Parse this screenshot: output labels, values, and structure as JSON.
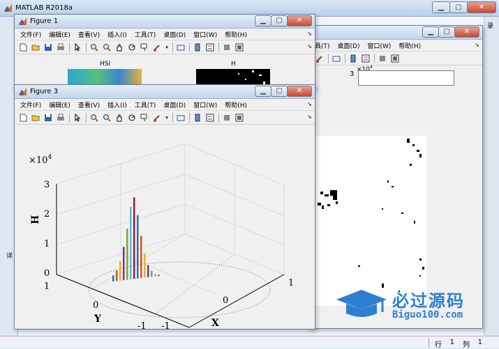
{
  "app": {
    "title": "MATLAB R2018a",
    "status_row_label": "行",
    "status_row_value": "1",
    "status_col_label": "列",
    "status_col_value": "1",
    "partial_left_label": "详",
    "partial_right_label": "录"
  },
  "window_buttons": {
    "minimize": "▁",
    "maximize": "▢",
    "close": "✕"
  },
  "menu": [
    "文件(F)",
    "编辑(E)",
    "查看(V)",
    "插入(I)",
    "工具(T)",
    "桌面(D)",
    "窗口(W)",
    "帮助(H)"
  ],
  "menu_overflow": "➘",
  "figure1": {
    "title": "Figure 1",
    "subplot_titles": [
      "HSI",
      "H"
    ]
  },
  "figure2": {
    "visible_menu": [
      "具(T)",
      "桌面(D)",
      "窗口(W)",
      "帮助(H)"
    ],
    "axis_exponent": "×10",
    "axis_exponent_power": "4",
    "axis_tick": "3"
  },
  "figure3": {
    "title": "Figure 3",
    "axes": {
      "z_exponent": "×10",
      "z_exponent_power": "4",
      "z_label": "H",
      "x_label": "X",
      "y_label": "Y",
      "z_ticks": [
        "0",
        "1",
        "2",
        "3"
      ],
      "y_ticks": [
        "1",
        "0",
        "-1"
      ],
      "x_ticks": [
        "-1",
        "0",
        "1"
      ]
    }
  },
  "watermark": {
    "main": "必过源码",
    "sub": "Biguo100.com"
  },
  "toolbar_icons": [
    "new-file-icon",
    "open-file-icon",
    "save-icon",
    "print-icon",
    "pointer-icon",
    "zoom-in-icon",
    "zoom-out-icon",
    "pan-icon",
    "rotate-3d-icon",
    "data-cursor-icon",
    "brush-icon",
    "link-icon",
    "colorbar-icon",
    "legend-icon",
    "hide-plot-tools-icon",
    "show-plot-tools-icon"
  ],
  "chart_data": {
    "type": "bar",
    "title": "",
    "zlabel": "H",
    "xlabel": "X",
    "ylabel": "Y",
    "zlim": [
      0,
      30000
    ],
    "xlim": [
      -1,
      1
    ],
    "ylim": [
      -1,
      1
    ],
    "grid": true,
    "bar_heights_near_origin": [
      2000,
      3500,
      6500,
      11000,
      17000,
      24000,
      27000,
      21000,
      14000,
      8000,
      4000,
      2000,
      800,
      400
    ]
  }
}
